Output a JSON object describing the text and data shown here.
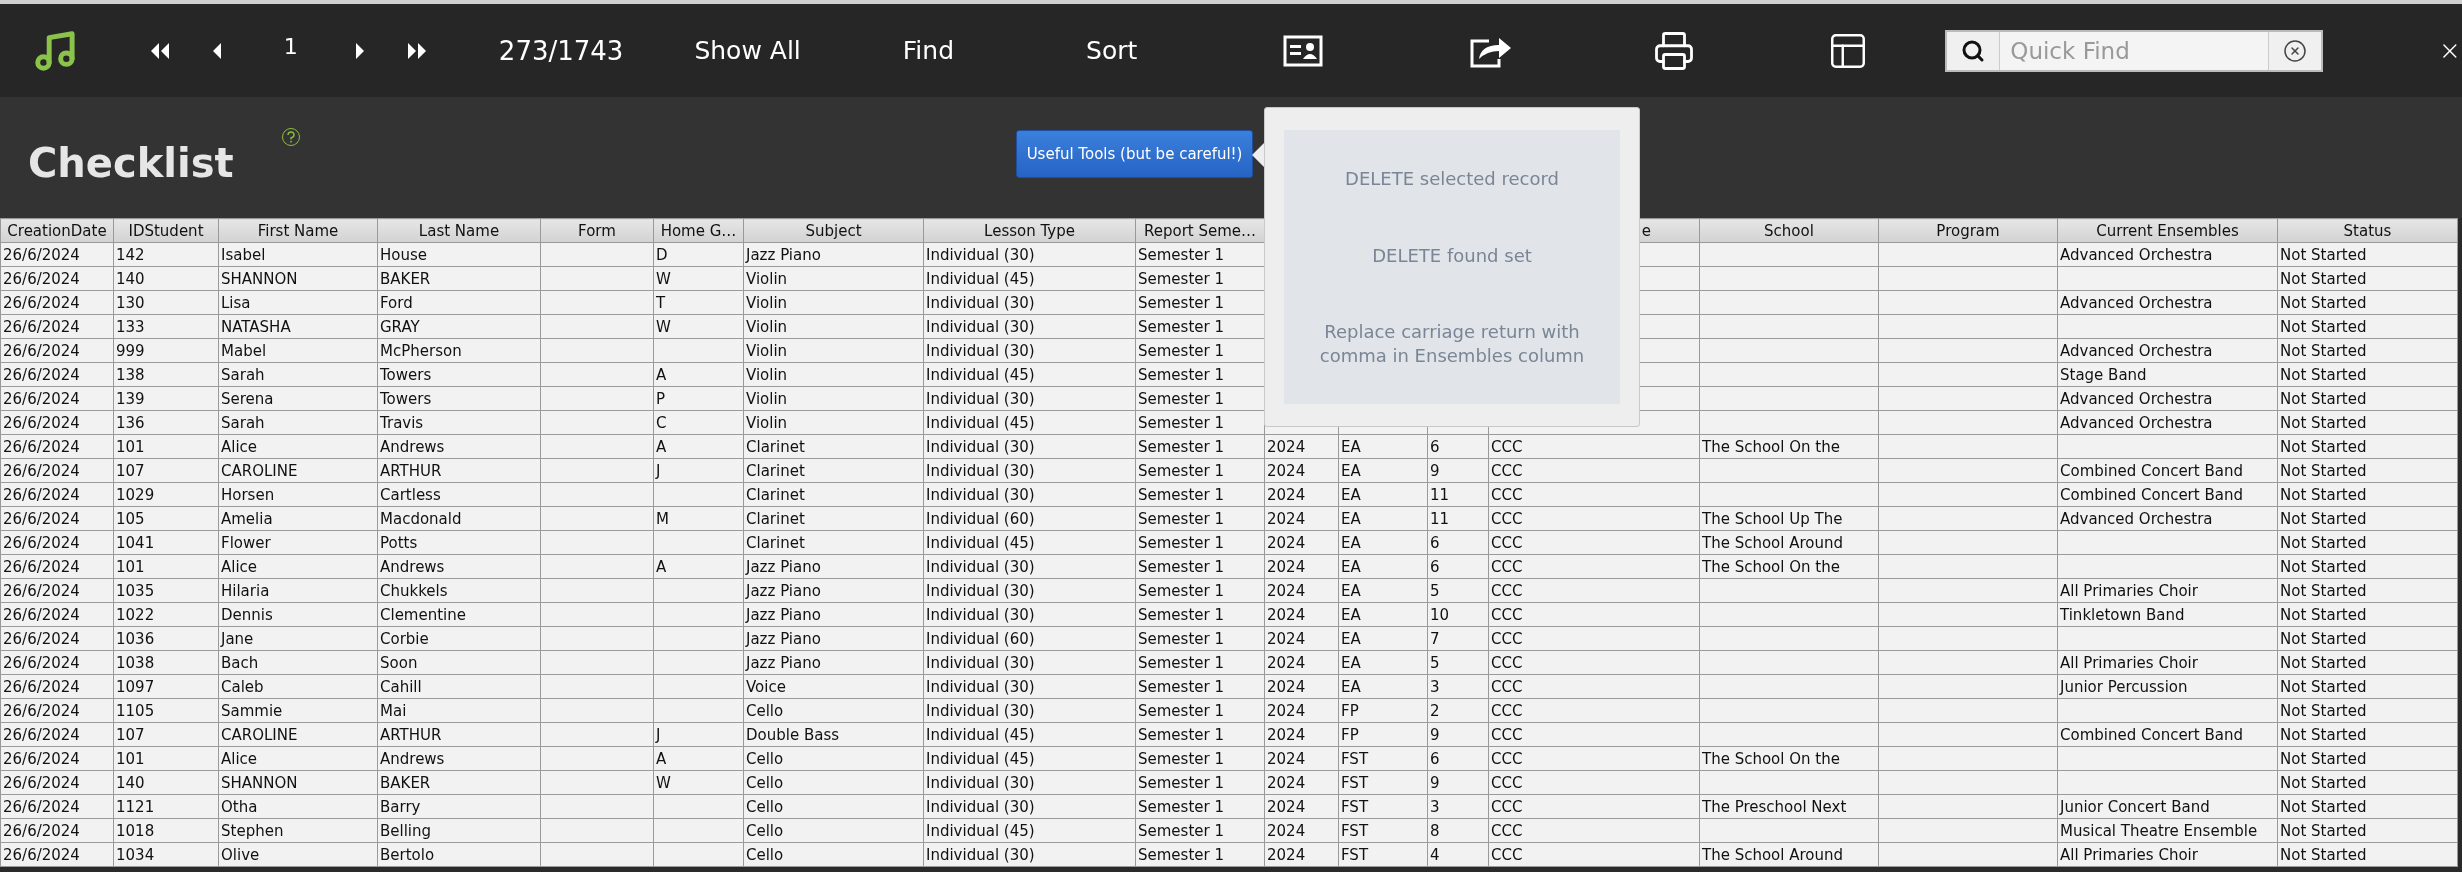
{
  "toolbar": {
    "record_number": "1",
    "record_count": "273/1743",
    "buttons": [
      "Show All",
      "Find",
      "Sort"
    ],
    "quick_find": {
      "placeholder": "Quick Find"
    }
  },
  "layout": {
    "title": "Checklist",
    "tools_button": "Useful Tools (but be careful!)"
  },
  "tools_popover": {
    "items": [
      "DELETE selected record",
      "DELETE found set",
      "Replace carriage return with comma in Ensembles column"
    ]
  },
  "table": {
    "columns": [
      {
        "label": "CreationDate"
      },
      {
        "label": "IDStudent"
      },
      {
        "label": "First Name"
      },
      {
        "label": "Last Name"
      },
      {
        "label": "Form"
      },
      {
        "label": "Home G…"
      },
      {
        "label": "Subject"
      },
      {
        "label": "Lesson Type"
      },
      {
        "label": "Report Seme…"
      },
      null,
      null,
      null,
      {
        "label": "e",
        "covered": true
      },
      {
        "label": "School"
      },
      {
        "label": "Program"
      },
      {
        "label": "Current Ensembles"
      },
      {
        "label": "Status"
      }
    ],
    "rows": [
      [
        "26/6/2024",
        "142",
        "Isabel",
        "House",
        null,
        "D",
        "Jazz Piano",
        "Individual (30)",
        "Semester 1",
        null,
        null,
        null,
        null,
        null,
        null,
        "Advanced Orchestra",
        "Not Started"
      ],
      [
        "26/6/2024",
        "140",
        "SHANNON",
        "BAKER",
        null,
        "W",
        "Violin",
        "Individual (45)",
        "Semester 1",
        null,
        null,
        null,
        null,
        null,
        null,
        null,
        "Not Started"
      ],
      [
        "26/6/2024",
        "130",
        "Lisa",
        "Ford",
        null,
        "T",
        "Violin",
        "Individual (30)",
        "Semester 1",
        null,
        null,
        null,
        null,
        null,
        null,
        "Advanced Orchestra",
        "Not Started"
      ],
      [
        "26/6/2024",
        "133",
        "NATASHA",
        "GRAY",
        null,
        "W",
        "Violin",
        "Individual (30)",
        "Semester 1",
        null,
        null,
        null,
        null,
        null,
        null,
        null,
        "Not Started"
      ],
      [
        "26/6/2024",
        "999",
        "Mabel",
        "McPherson",
        null,
        null,
        "Violin",
        "Individual (30)",
        "Semester 1",
        null,
        null,
        null,
        null,
        null,
        null,
        "Advanced Orchestra",
        "Not Started"
      ],
      [
        "26/6/2024",
        "138",
        "Sarah",
        "Towers",
        null,
        "A",
        "Violin",
        "Individual (45)",
        "Semester 1",
        null,
        null,
        null,
        null,
        null,
        null,
        "Stage Band",
        "Not Started"
      ],
      [
        "26/6/2024",
        "139",
        "Serena",
        "Towers",
        null,
        "P",
        "Violin",
        "Individual (30)",
        "Semester 1",
        null,
        null,
        null,
        null,
        null,
        null,
        "Advanced Orchestra",
        "Not Started"
      ],
      [
        "26/6/2024",
        "136",
        "Sarah",
        "Travis",
        null,
        "C",
        "Violin",
        "Individual (45)",
        "Semester 1",
        null,
        null,
        null,
        null,
        null,
        null,
        "Advanced Orchestra",
        "Not Started"
      ],
      [
        "26/6/2024",
        "101",
        "Alice",
        "Andrews",
        null,
        "A",
        "Clarinet",
        "Individual (30)",
        "Semester 1",
        "2024",
        "EA",
        "6",
        "CCC",
        "The School On the",
        null,
        null,
        "Not Started"
      ],
      [
        "26/6/2024",
        "107",
        "CAROLINE",
        "ARTHUR",
        null,
        "J",
        "Clarinet",
        "Individual (30)",
        "Semester 1",
        "2024",
        "EA",
        "9",
        "CCC",
        null,
        null,
        "Combined Concert Band",
        "Not Started"
      ],
      [
        "26/6/2024",
        "1029",
        "Horsen",
        "Cartless",
        null,
        null,
        "Clarinet",
        "Individual (30)",
        "Semester 1",
        "2024",
        "EA",
        "11",
        "CCC",
        null,
        null,
        "Combined Concert Band",
        "Not Started"
      ],
      [
        "26/6/2024",
        "105",
        "Amelia",
        "Macdonald",
        null,
        "M",
        "Clarinet",
        "Individual (60)",
        "Semester 1",
        "2024",
        "EA",
        "11",
        "CCC",
        "The School Up The",
        null,
        "Advanced Orchestra",
        "Not Started"
      ],
      [
        "26/6/2024",
        "1041",
        "Flower",
        "Potts",
        null,
        null,
        "Clarinet",
        "Individual (45)",
        "Semester 1",
        "2024",
        "EA",
        "6",
        "CCC",
        "The School Around",
        null,
        null,
        "Not Started"
      ],
      [
        "26/6/2024",
        "101",
        "Alice",
        "Andrews",
        null,
        "A",
        "Jazz Piano",
        "Individual (30)",
        "Semester 1",
        "2024",
        "EA",
        "6",
        "CCC",
        "The School On the",
        null,
        null,
        "Not Started"
      ],
      [
        "26/6/2024",
        "1035",
        "Hilaria",
        "Chukkels",
        null,
        null,
        "Jazz Piano",
        "Individual (30)",
        "Semester 1",
        "2024",
        "EA",
        "5",
        "CCC",
        null,
        null,
        "All Primaries Choir",
        "Not Started"
      ],
      [
        "26/6/2024",
        "1022",
        "Dennis",
        "Clementine",
        null,
        null,
        "Jazz Piano",
        "Individual (30)",
        "Semester 1",
        "2024",
        "EA",
        "10",
        "CCC",
        null,
        null,
        "Tinkletown Band",
        "Not Started"
      ],
      [
        "26/6/2024",
        "1036",
        "Jane",
        "Corbie",
        null,
        null,
        "Jazz Piano",
        "Individual (60)",
        "Semester 1",
        "2024",
        "EA",
        "7",
        "CCC",
        null,
        null,
        null,
        "Not Started"
      ],
      [
        "26/6/2024",
        "1038",
        "Bach",
        "Soon",
        null,
        null,
        "Jazz Piano",
        "Individual (30)",
        "Semester 1",
        "2024",
        "EA",
        "5",
        "CCC",
        null,
        null,
        "All Primaries Choir",
        "Not Started"
      ],
      [
        "26/6/2024",
        "1097",
        "Caleb",
        "Cahill",
        null,
        null,
        "Voice",
        "Individual (30)",
        "Semester 1",
        "2024",
        "EA",
        "3",
        "CCC",
        null,
        null,
        "Junior Percussion",
        "Not Started"
      ],
      [
        "26/6/2024",
        "1105",
        "Sammie",
        "Mai",
        null,
        null,
        "Cello",
        "Individual (30)",
        "Semester 1",
        "2024",
        "FP",
        "2",
        "CCC",
        null,
        null,
        null,
        "Not Started"
      ],
      [
        "26/6/2024",
        "107",
        "CAROLINE",
        "ARTHUR",
        null,
        "J",
        "Double Bass",
        "Individual (45)",
        "Semester 1",
        "2024",
        "FP",
        "9",
        "CCC",
        null,
        null,
        "Combined Concert Band",
        "Not Started"
      ],
      [
        "26/6/2024",
        "101",
        "Alice",
        "Andrews",
        null,
        "A",
        "Cello",
        "Individual (45)",
        "Semester 1",
        "2024",
        "FST",
        "6",
        "CCC",
        "The School On the",
        null,
        null,
        "Not Started"
      ],
      [
        "26/6/2024",
        "140",
        "SHANNON",
        "BAKER",
        null,
        "W",
        "Cello",
        "Individual (30)",
        "Semester 1",
        "2024",
        "FST",
        "9",
        "CCC",
        null,
        null,
        null,
        "Not Started"
      ],
      [
        "26/6/2024",
        "1121",
        "Otha",
        "Barry",
        null,
        null,
        "Cello",
        "Individual (30)",
        "Semester 1",
        "2024",
        "FST",
        "3",
        "CCC",
        "The Preschool Next",
        null,
        "Junior Concert Band",
        "Not Started"
      ],
      [
        "26/6/2024",
        "1018",
        "Stephen",
        "Belling",
        null,
        null,
        "Cello",
        "Individual (45)",
        "Semester 1",
        "2024",
        "FST",
        "8",
        "CCC",
        null,
        null,
        "Musical Theatre Ensemble",
        "Not Started"
      ],
      [
        "26/6/2024",
        "1034",
        "Olive",
        "Bertolo",
        null,
        null,
        "Cello",
        "Individual (30)",
        "Semester 1",
        "2024",
        "FST",
        "4",
        "CCC",
        "The School Around",
        null,
        "All Primaries Choir",
        "Not Started"
      ]
    ]
  }
}
